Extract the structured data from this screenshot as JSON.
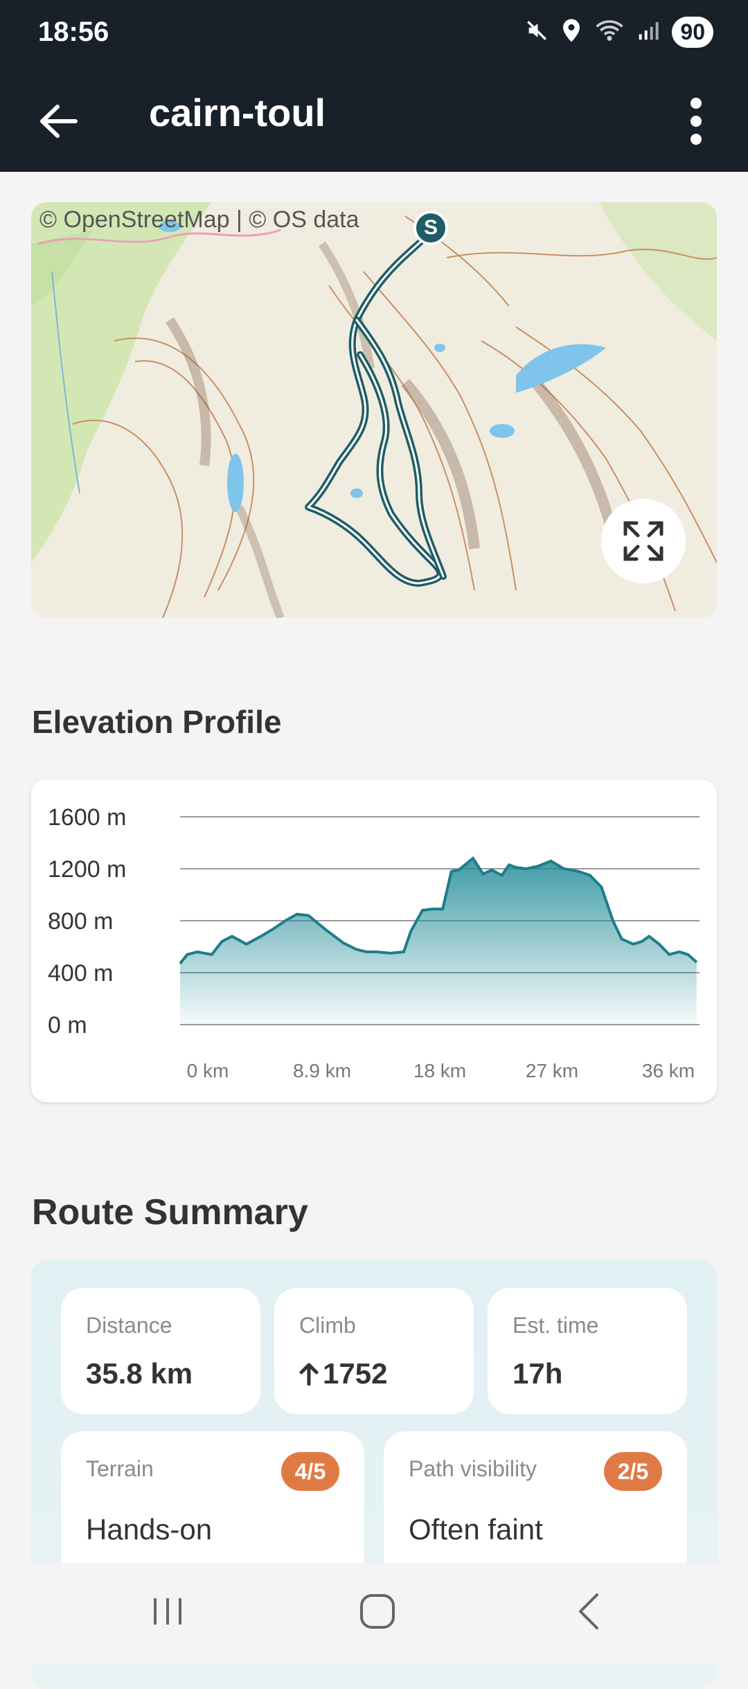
{
  "status_bar": {
    "time": "18:56",
    "battery": "90"
  },
  "app_bar": {
    "title": "cairn-toul"
  },
  "map": {
    "credit": "© OpenStreetMap | © OS data",
    "start_marker": "S"
  },
  "elevation": {
    "title": "Elevation Profile",
    "chart_data": {
      "type": "area",
      "title": "",
      "xlabel": "",
      "ylabel": "",
      "y_ticks": [
        "1600 m",
        "1200 m",
        "800 m",
        "400 m",
        "0 m"
      ],
      "x_ticks": [
        "0 km",
        "8.9 km",
        "18 km",
        "27 km",
        "36 km"
      ],
      "xlim": [
        0,
        36
      ],
      "ylim": [
        0,
        1600
      ],
      "grid": true,
      "series": [
        {
          "x": [
            0,
            0.5,
            1.2,
            2.2,
            2.9,
            3.6,
            4.6,
            5.6,
            6.5,
            7.3,
            8.1,
            8.9,
            10.1,
            11.3,
            12.2,
            12.9,
            13.6,
            14.6,
            15.5,
            16.0,
            16.8,
            17.5,
            18.2,
            18.8,
            19.3,
            20.3,
            21.0,
            21.6,
            22.3,
            22.8,
            23.3,
            24.0,
            24.8,
            25.7,
            26.6,
            27.6,
            28.4,
            29.2,
            30.0,
            30.6,
            31.4,
            32.0,
            32.5,
            33.2,
            33.9,
            34.6,
            35.2,
            35.8
          ],
          "y": [
            470,
            540,
            560,
            540,
            640,
            680,
            620,
            680,
            740,
            800,
            850,
            840,
            730,
            630,
            580,
            560,
            560,
            550,
            560,
            720,
            880,
            890,
            890,
            1180,
            1190,
            1280,
            1160,
            1190,
            1150,
            1230,
            1210,
            1200,
            1220,
            1260,
            1200,
            1180,
            1150,
            1060,
            800,
            660,
            620,
            640,
            680,
            620,
            540,
            560,
            540,
            480
          ]
        }
      ]
    }
  },
  "summary": {
    "title": "Route Summary",
    "distance": {
      "label": "Distance",
      "value": "35.8 km"
    },
    "climb": {
      "label": "Climb",
      "value": "1752"
    },
    "time": {
      "label": "Est. time",
      "value": "17h"
    },
    "terrain": {
      "label": "Terrain",
      "badge": "4/5",
      "value": "Hands-on"
    },
    "visibility": {
      "label": "Path visibility",
      "badge": "2/5",
      "value": "Often faint"
    }
  },
  "colors": {
    "header": "#18202a",
    "accent": "#1e7d89",
    "badge": "#e07a45"
  },
  "icons": [
    "muted-icon",
    "location-icon",
    "wifi-icon",
    "signal-icon",
    "back-arrow-icon",
    "more-vert-icon",
    "expand-icon",
    "arrow-up-icon",
    "recents-icon",
    "home-icon",
    "back-nav-icon"
  ]
}
